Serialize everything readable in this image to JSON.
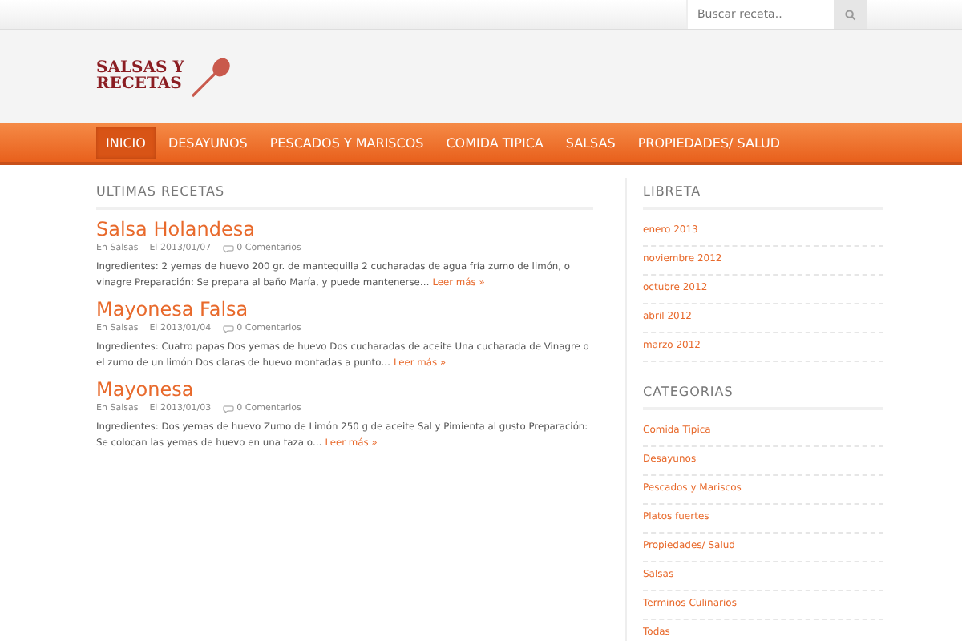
{
  "search": {
    "placeholder": "Buscar receta.."
  },
  "logo": {
    "lines": [
      "SALSAS Y",
      "RECETAS"
    ]
  },
  "nav": [
    {
      "label": "INICIO",
      "selected": true
    },
    {
      "label": "DESAYUNOS",
      "selected": false
    },
    {
      "label": "PESCADOS Y MARISCOS",
      "selected": false
    },
    {
      "label": "COMIDA TIPICA",
      "selected": false
    },
    {
      "label": "SALSAS",
      "selected": false
    },
    {
      "label": "PROPIEDADES/ SALUD",
      "selected": false
    }
  ],
  "main": {
    "heading": "ULTIMAS RECETAS",
    "posts": [
      {
        "title": "Salsa Holandesa",
        "category": "En Salsas",
        "date": "El 2013/01/07",
        "comments": "0 Comentarios",
        "excerpt": "Ingredientes: 2 yemas de huevo 200 gr. de mantequilla 2 cucharadas de agua fría zumo de limón, o vinagre Preparación: Se prepara al baño María, y puede mantenerse…",
        "more": "Leer más »"
      },
      {
        "title": "Mayonesa Falsa",
        "category": "En Salsas",
        "date": "El 2013/01/04",
        "comments": "0 Comentarios",
        "excerpt": "Ingredientes: Cuatro papas Dos yemas de huevo Dos cucharadas de aceite Una cucharada de Vinagre o el zumo de un limón Dos claras de huevo montadas a punto…",
        "more": "Leer más »"
      },
      {
        "title": "Mayonesa",
        "category": "En Salsas",
        "date": "El 2013/01/03",
        "comments": "0 Comentarios",
        "excerpt": "Ingredientes: Dos yemas de huevo Zumo de Limón 250 g de aceite Sal y Pimienta al gusto Preparación: Se colocan las yemas de huevo en una taza o…",
        "more": "Leer más »"
      }
    ]
  },
  "sidebar": [
    {
      "heading": "LIBRETA",
      "items": [
        "enero 2013",
        "noviembre 2012",
        "octubre 2012",
        "abril 2012",
        "marzo 2012"
      ]
    },
    {
      "heading": "CATEGORIAS",
      "items": [
        "Comida Tipica",
        "Desayunos",
        "Pescados y Mariscos",
        "Platos fuertes",
        "Propiedades/ Salud",
        "Salsas",
        "Terminos Culinarios",
        "Todas"
      ]
    }
  ]
}
